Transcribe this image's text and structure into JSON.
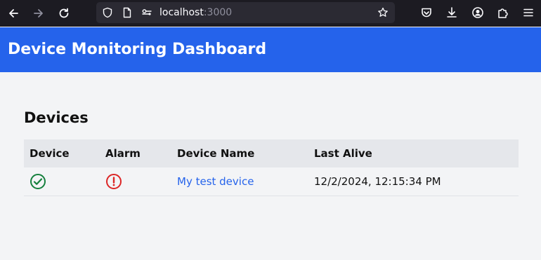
{
  "browser": {
    "url_host": "localhost",
    "url_port": ":3000",
    "icons": [
      "back-icon",
      "forward-icon",
      "reload-icon",
      "shield-icon",
      "page-icon",
      "connection-icon",
      "bookmark-star-icon",
      "pocket-icon",
      "download-icon",
      "account-icon",
      "extensions-icon",
      "menu-icon"
    ]
  },
  "header": {
    "title": "Device Monitoring Dashboard"
  },
  "main": {
    "section_title": "Devices",
    "table": {
      "columns": [
        "Device",
        "Alarm",
        "Device Name",
        "Last Alive"
      ],
      "rows": [
        {
          "device_status": "ok",
          "alarm_status": "alert",
          "device_name": "My test device",
          "last_alive": "12/2/2024, 12:15:34 PM"
        }
      ]
    }
  },
  "colors": {
    "header_bg": "#2563eb",
    "ok": "#15803d",
    "alarm": "#dc2626",
    "link": "#2563eb"
  }
}
